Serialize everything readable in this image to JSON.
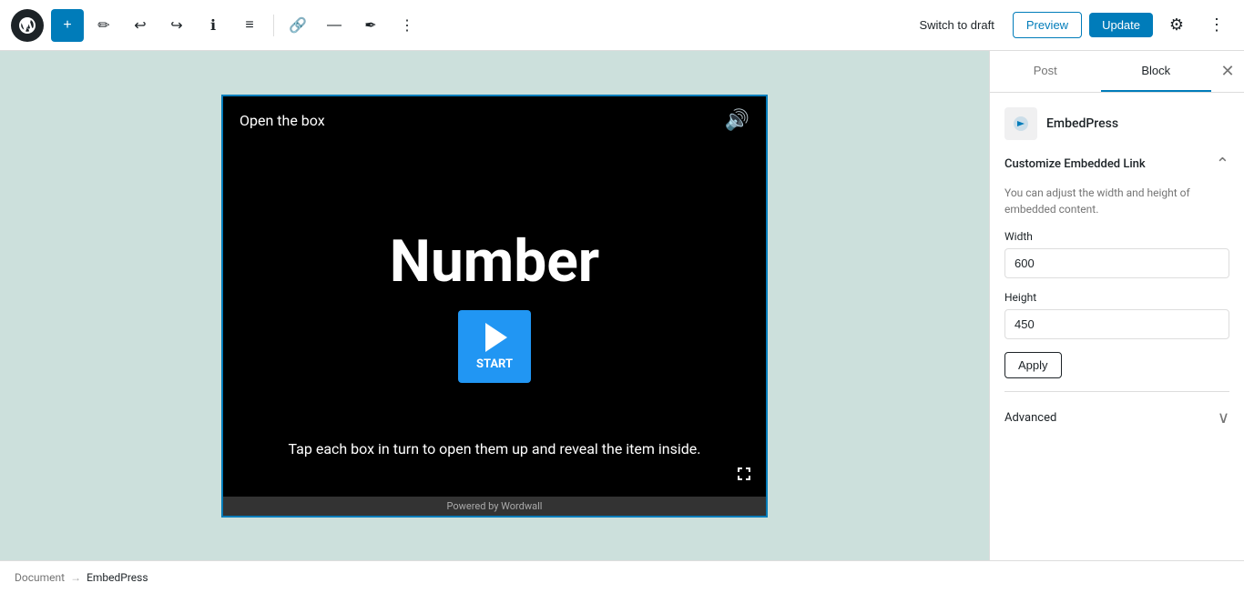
{
  "toolbar": {
    "add_label": "+",
    "switch_draft_label": "Switch to draft",
    "preview_label": "Preview",
    "update_label": "Update",
    "more_label": "⋮"
  },
  "tabs": {
    "post_label": "Post",
    "block_label": "Block"
  },
  "block_panel": {
    "block_name": "EmbedPress",
    "customize_title": "Customize Embedded Link",
    "customize_desc": "You can adjust the width and height of embedded content.",
    "width_label": "Width",
    "width_value": "600",
    "height_label": "Height",
    "height_value": "450",
    "apply_label": "Apply",
    "advanced_label": "Advanced"
  },
  "embed": {
    "title": "Open the box",
    "number_label": "Number",
    "start_label": "START",
    "desc": "Tap each box in turn to open them up and reveal the item inside.",
    "footer": "Powered by Wordwall"
  },
  "breadcrumb": {
    "document_label": "Document",
    "separator": "→",
    "current_label": "EmbedPress"
  },
  "icons": {
    "close": "✕",
    "chevron_up": "^",
    "chevron_down": "∨",
    "settings": "⚙",
    "speaker": "🔊",
    "fullscreen": "⛶"
  }
}
